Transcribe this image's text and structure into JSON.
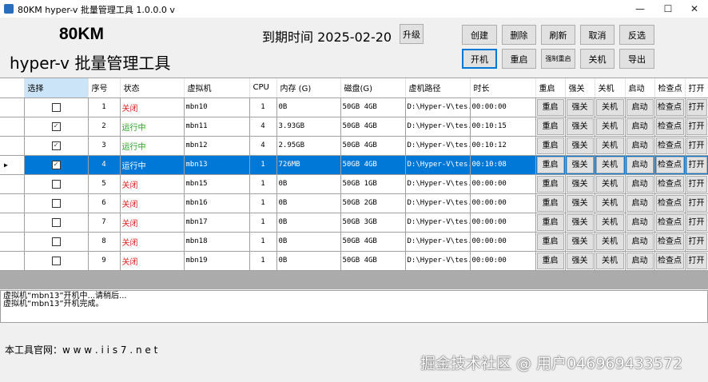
{
  "window": {
    "title": "80KM hyper-v 批量管理工具 1.0.0.0 v",
    "minimize": "—",
    "maximize": "☐",
    "close": "✕"
  },
  "header": {
    "brand": "80KM",
    "subtitle": "hyper-v 批量管理工具",
    "expiry": "到期时间 2025-02-20",
    "upgrade": "升级"
  },
  "toolbar": {
    "row1": [
      "创建",
      "删除",
      "刷新",
      "取消",
      "反选"
    ],
    "row2": [
      "开机",
      "重启",
      "强制重启",
      "关机",
      "导出"
    ]
  },
  "grid": {
    "columns": [
      "选择",
      "序号",
      "状态",
      "虚拟机",
      "CPU",
      "内存 (G)",
      "磁盘(G)",
      "虚机路径",
      "时长",
      "重启",
      "强关",
      "关机",
      "启动",
      "检查点",
      "打开"
    ],
    "action_labels": [
      "重启",
      "强关",
      "关机",
      "启动",
      "检查点",
      "打开"
    ],
    "selected_row": 3,
    "rows": [
      {
        "checked": false,
        "no": "1",
        "status": "关闭",
        "vm": "mbn10",
        "cpu": "1",
        "mem": "0B",
        "disk": "50GB 4GB",
        "path": "D:\\Hyper-V\\tes...",
        "time": "00:00:00"
      },
      {
        "checked": true,
        "no": "2",
        "status": "运行中",
        "vm": "mbn11",
        "cpu": "4",
        "mem": "3.93GB",
        "disk": "50GB 4GB",
        "path": "D:\\Hyper-V\\tes...",
        "time": "00:10:15"
      },
      {
        "checked": true,
        "no": "3",
        "status": "运行中",
        "vm": "mbn12",
        "cpu": "4",
        "mem": "2.95GB",
        "disk": "50GB 4GB",
        "path": "D:\\Hyper-V\\tes...",
        "time": "00:10:12"
      },
      {
        "checked": true,
        "no": "4",
        "status": "运行中",
        "vm": "mbn13",
        "cpu": "1",
        "mem": "726MB",
        "disk": "50GB 4GB",
        "path": "D:\\Hyper-V\\tes...",
        "time": "00:10:08"
      },
      {
        "checked": false,
        "no": "5",
        "status": "关闭",
        "vm": "mbn15",
        "cpu": "1",
        "mem": "0B",
        "disk": "50GB 1GB",
        "path": "D:\\Hyper-V\\tes...",
        "time": "00:00:00"
      },
      {
        "checked": false,
        "no": "6",
        "status": "关闭",
        "vm": "mbn16",
        "cpu": "1",
        "mem": "0B",
        "disk": "50GB 2GB",
        "path": "D:\\Hyper-V\\tes...",
        "time": "00:00:00"
      },
      {
        "checked": false,
        "no": "7",
        "status": "关闭",
        "vm": "mbn17",
        "cpu": "1",
        "mem": "0B",
        "disk": "50GB 3GB",
        "path": "D:\\Hyper-V\\tes...",
        "time": "00:00:00"
      },
      {
        "checked": false,
        "no": "8",
        "status": "关闭",
        "vm": "mbn18",
        "cpu": "1",
        "mem": "0B",
        "disk": "50GB 4GB",
        "path": "D:\\Hyper-V\\tes...",
        "time": "00:00:00"
      },
      {
        "checked": false,
        "no": "9",
        "status": "关闭",
        "vm": "mbn19",
        "cpu": "1",
        "mem": "0B",
        "disk": "50GB 4GB",
        "path": "D:\\Hyper-V\\tes...",
        "time": "00:00:00"
      }
    ]
  },
  "log": [
    "虚拟机“mbn13”开机中...请稍后...",
    "虚拟机“mbn13”开机完成。"
  ],
  "footer": {
    "site": "本工具官网：w w w . i i s 7 . n e t",
    "watermark": "掘金技术社区 @ 用户046969433572"
  },
  "colors": {
    "selection": "#0078d7",
    "running": "#22a322",
    "stopped": "#e02020"
  }
}
